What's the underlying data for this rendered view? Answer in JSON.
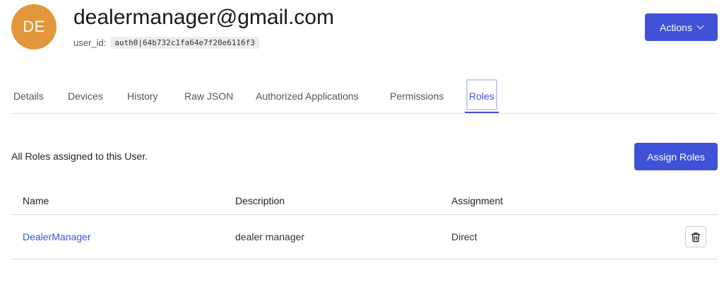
{
  "user": {
    "avatar_initials": "DE",
    "avatar_color": "#e3973a",
    "email": "dealermanager@gmail.com",
    "user_id_label": "user_id:",
    "user_id_value": "auth0|64b732c1fa64e7f20e6116f3"
  },
  "header": {
    "actions_label": "Actions"
  },
  "tabs": [
    {
      "label": "Details"
    },
    {
      "label": "Devices"
    },
    {
      "label": "History"
    },
    {
      "label": "Raw JSON"
    },
    {
      "label": "Authorized Applications"
    },
    {
      "label": "Permissions"
    },
    {
      "label": "Roles",
      "active": true
    }
  ],
  "roles": {
    "description": "All Roles assigned to this User.",
    "assign_label": "Assign Roles",
    "columns": [
      "Name",
      "Description",
      "Assignment"
    ],
    "rows": [
      {
        "name": "DealerManager",
        "description": "dealer manager",
        "assignment": "Direct"
      }
    ]
  },
  "colors": {
    "accent": "#3f51d6",
    "avatar": "#e3973a"
  },
  "icons": {
    "actions_dropdown": "chevron-down-icon",
    "row_delete": "trash-icon"
  }
}
